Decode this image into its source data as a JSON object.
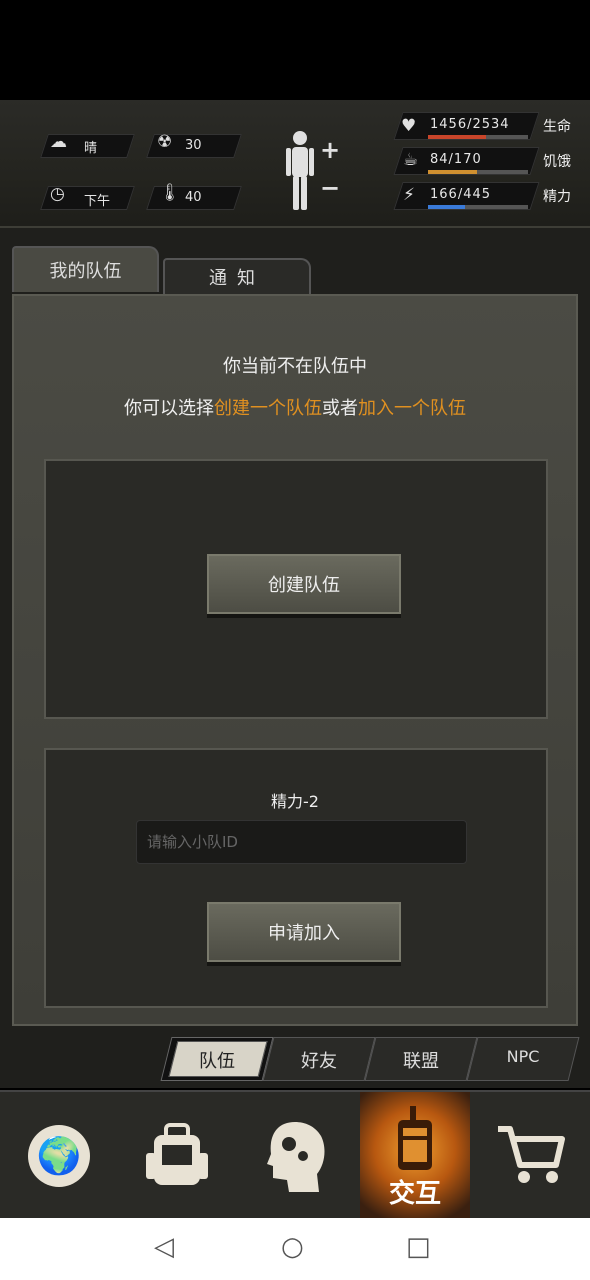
{
  "hud": {
    "weather": "晴",
    "radiation": "30",
    "time_of_day": "下午",
    "temperature": "40",
    "health": {
      "value": "1456/2534",
      "label": "生命",
      "fraction": 0.575,
      "color": "#c8452a"
    },
    "hunger": {
      "value": "84/170",
      "label": "饥饿",
      "fraction": 0.494,
      "color": "#d09030"
    },
    "energy": {
      "value": "166/445",
      "label": "精力",
      "fraction": 0.373,
      "color": "#3a7ad8"
    }
  },
  "tabs": {
    "my_team": "我的队伍",
    "notice": "通知"
  },
  "panel": {
    "line1": "你当前不在队伍中",
    "line2_prefix": "你可以选择",
    "line2_create": "创建一个队伍",
    "line2_or": "或者",
    "line2_join": "加入一个队伍",
    "create_button": "创建队伍",
    "energy_cost": "精力-2",
    "id_placeholder": "请输入小队ID",
    "join_button": "申请加入"
  },
  "subtabs": [
    "队伍",
    "好友",
    "联盟",
    "NPC"
  ],
  "bottom_nav": {
    "interact_label": "交互",
    "icons": [
      "globe-icon",
      "backpack-icon",
      "head-gears-icon",
      "walkie-talkie-icon",
      "cart-icon"
    ]
  }
}
